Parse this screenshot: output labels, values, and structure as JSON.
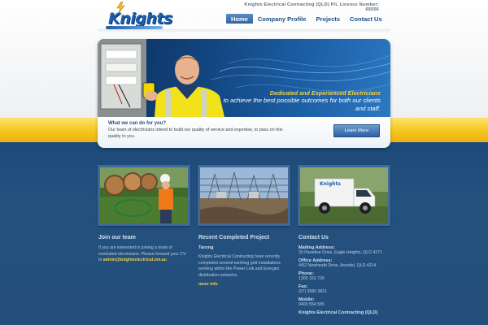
{
  "header": {
    "logo_text": "Knights",
    "licence": "Knights Electrical Contracting (QLD) P/L Licence Number: 65556"
  },
  "nav": {
    "items": [
      {
        "label": "Home",
        "active": true
      },
      {
        "label": "Company Profile",
        "active": false
      },
      {
        "label": "Projects",
        "active": false
      },
      {
        "label": "Contact Us",
        "active": false
      }
    ]
  },
  "hero": {
    "tagline_1": "Dedicated and Experienced Electricians",
    "tagline_2": "to achieve the best possible outcomes for both our clients and staff.",
    "what_title": "What we can do for you?",
    "what_text": "Our team of electricians intend to build our quality of service and expertise, to pass on this quality to you.",
    "button": "Learn More"
  },
  "join": {
    "title": "Join our team",
    "text": "If you are interested in joining a team of motivated electricians. Please forward your CV to",
    "email": "admin@knightselectrical.net.au"
  },
  "project": {
    "title": "Recent Completed Project",
    "subtitle": "Tarong",
    "text": "Knights Electrical Contracting have recently completed several earthing grid installations working within the Power Link and Energex distribution networks.",
    "more": "more info"
  },
  "contact": {
    "title": "Contact Us",
    "mailing_label": "Mailing Address:",
    "mailing_value": "33 Paradise Drive, Eagle Heights, QLD 4271",
    "office_label": "Office Address:",
    "office_value": "4/52 Newheath Drive, Arundel, QLD 4214",
    "phone_label": "Phone:",
    "phone_value": "1300 153 726",
    "fax_label": "Fax:",
    "fax_value": "(07) 5580 3821",
    "mobile_label": "Mobile:",
    "mobile_value": "0400 554 555",
    "company": "Knights Electrical Contracting (QLD)"
  },
  "colors": {
    "brand_blue": "#1f4f86",
    "accent_yellow": "#f5c51e",
    "page_blue": "#24507e"
  }
}
